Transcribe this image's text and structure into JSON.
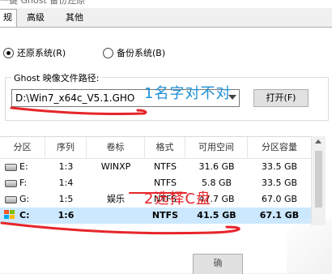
{
  "window": {
    "title": "一键 Ghost 备份还原"
  },
  "tabs": [
    {
      "label": "规",
      "active": true
    },
    {
      "label": "高级",
      "active": false
    },
    {
      "label": "其他",
      "active": false
    }
  ],
  "mode": {
    "restore_label": "还原系统(R)",
    "backup_label": "备份系统(B)",
    "selected": "restore"
  },
  "image_group": {
    "title": "Ghost 映像文件路径:",
    "path_value": "D:\\Win7_x64c_V5.1.GHO",
    "open_button": "打开(F)"
  },
  "table": {
    "headers": [
      "分区",
      "序列",
      "卷标",
      "格式",
      "可用空间",
      "分区容量"
    ],
    "rows": [
      {
        "drive": "E:",
        "seq": "1:3",
        "label": "WINXP",
        "fs": "NTFS",
        "free": "31.6 GB",
        "size": "33.5 GB",
        "icon": "disk-icon",
        "selected": false
      },
      {
        "drive": "F:",
        "seq": "1:4",
        "label": "",
        "fs": "NTFS",
        "free": "5.8 GB",
        "size": "33.5 GB",
        "icon": "disk-icon",
        "selected": false
      },
      {
        "drive": "G:",
        "seq": "1:5",
        "label": "娱乐",
        "fs": "NTFS",
        "free": "47.7 GB",
        "size": "67.0 GB",
        "icon": "disk-icon",
        "selected": false
      },
      {
        "drive": "C:",
        "seq": "1:6",
        "label": "",
        "fs": "NTFS",
        "free": "41.5 GB",
        "size": "67.1 GB",
        "icon": "windows-icon",
        "selected": true
      }
    ]
  },
  "bottom_button": {
    "label": "确"
  },
  "annotations": [
    {
      "text": "1名字对不对",
      "color": "#1e8fd6"
    },
    {
      "text": "2选择C盘",
      "color": "#e6262a"
    }
  ],
  "colors": {
    "selection": "#cce8ff",
    "annotation_stroke": "#e6262a"
  }
}
